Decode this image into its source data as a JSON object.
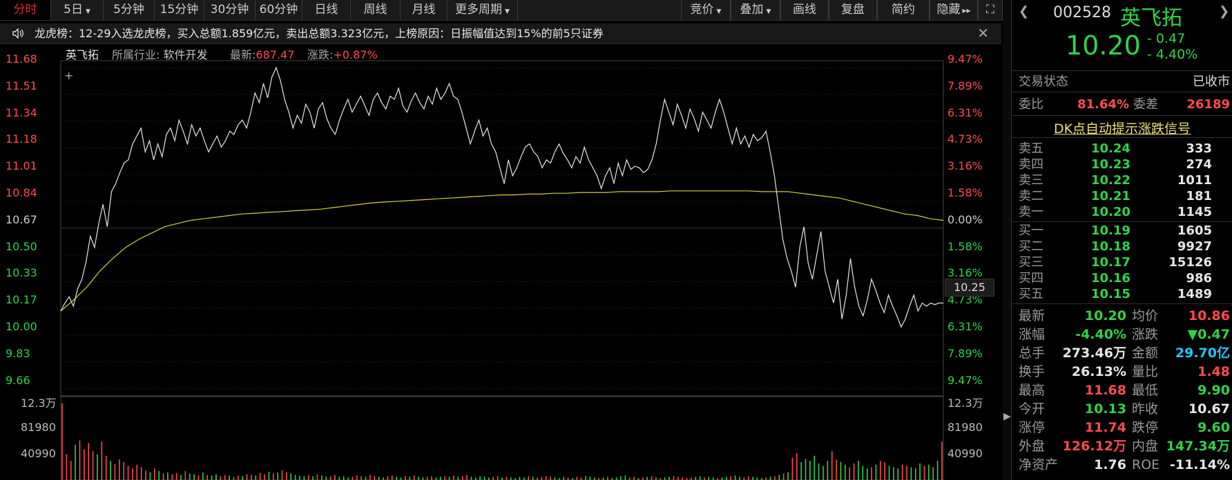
{
  "tabs": [
    {
      "label": "分时",
      "active": true
    },
    {
      "label": "5日",
      "dropdown": true
    },
    {
      "label": "5分钟"
    },
    {
      "label": "15分钟"
    },
    {
      "label": "30分钟"
    },
    {
      "label": "60分钟"
    },
    {
      "label": "日线"
    },
    {
      "label": "周线"
    },
    {
      "label": "月线"
    },
    {
      "label": "更多周期",
      "dropdown": true
    }
  ],
  "toolbar": [
    {
      "label": "竞价",
      "dropdown": true
    },
    {
      "label": "叠加",
      "dropdown": true
    },
    {
      "label": "画线"
    },
    {
      "label": "复盘"
    },
    {
      "label": "简约"
    },
    {
      "label": "隐藏",
      "arrows": "▸▸"
    }
  ],
  "notice": "龙虎榜：12-29入选龙虎榜，买入总额1.859亿元，卖出总额3.323亿元，上榜原因：日振幅值达到15%的前5只证券",
  "info": {
    "name": "英飞拓",
    "industry_label": "所属行业:",
    "industry": "软件开发",
    "latest_label": "最新:",
    "latest": "687.47",
    "change_label": "涨跌:",
    "change": "+0.87%"
  },
  "price_axis": [
    "11.68",
    "11.51",
    "11.34",
    "11.18",
    "11.01",
    "10.84",
    "10.67",
    "10.50",
    "10.33",
    "10.17",
    "10.00",
    "9.83",
    "9.66"
  ],
  "pct_axis": [
    "9.47%",
    "7.89%",
    "6.31%",
    "4.73%",
    "3.16%",
    "1.58%",
    "0.00%",
    "1.58%",
    "3.16%",
    "4.73%",
    "6.31%",
    "7.89%",
    "9.47%"
  ],
  "crosshair_price": "10.25",
  "vol_axis": [
    "12.3万",
    "81980",
    "40990"
  ],
  "colors": {
    "up": "#ff4b4b",
    "down": "#2fd34a",
    "neutral": "#e8e8e8",
    "avg": "#d8d033",
    "accent": "#1ea0ff"
  },
  "stock": {
    "code": "002528",
    "name": "英飞拓",
    "price": "10.20",
    "change": "- 0.47",
    "change_pct": "- 4.40%"
  },
  "status": {
    "label": "交易状态",
    "value": "已收市"
  },
  "wei": {
    "ratio_label": "委比",
    "ratio": "81.64%",
    "diff_label": "委差",
    "diff": "26189"
  },
  "dk_signal": "DK点自动提示涨跌信号",
  "sells": [
    {
      "label": "卖五",
      "price": "10.24",
      "vol": "333"
    },
    {
      "label": "卖四",
      "price": "10.23",
      "vol": "274"
    },
    {
      "label": "卖三",
      "price": "10.22",
      "vol": "1011"
    },
    {
      "label": "卖二",
      "price": "10.21",
      "vol": "181"
    },
    {
      "label": "卖一",
      "price": "10.20",
      "vol": "1145"
    }
  ],
  "buys": [
    {
      "label": "买一",
      "price": "10.19",
      "vol": "1605"
    },
    {
      "label": "买二",
      "price": "10.18",
      "vol": "9927"
    },
    {
      "label": "买三",
      "price": "10.17",
      "vol": "15126"
    },
    {
      "label": "买四",
      "price": "10.16",
      "vol": "986"
    },
    {
      "label": "买五",
      "price": "10.15",
      "vol": "1489"
    }
  ],
  "stats": [
    [
      {
        "l": "最新",
        "v": "10.20",
        "c": "green"
      },
      {
        "l": "均价",
        "v": "10.86",
        "c": "red"
      }
    ],
    [
      {
        "l": "涨幅",
        "v": "-4.40%",
        "c": "green"
      },
      {
        "l": "涨跌",
        "v": "▼0.47",
        "c": "green"
      }
    ],
    [
      {
        "l": "总手",
        "v": "273.46万",
        "c": "white"
      },
      {
        "l": "金额",
        "v": "29.70亿",
        "c": "blue"
      }
    ],
    [
      {
        "l": "换手",
        "v": "26.13%",
        "c": "white"
      },
      {
        "l": "量比",
        "v": "1.48",
        "c": "red"
      }
    ],
    [
      {
        "l": "最高",
        "v": "11.68",
        "c": "red"
      },
      {
        "l": "最低",
        "v": "9.90",
        "c": "green"
      }
    ],
    [
      {
        "l": "今开",
        "v": "10.13",
        "c": "green"
      },
      {
        "l": "昨收",
        "v": "10.67",
        "c": "white"
      }
    ],
    [
      {
        "l": "涨停",
        "v": "11.74",
        "c": "red"
      },
      {
        "l": "跌停",
        "v": "9.60",
        "c": "green"
      }
    ],
    [
      {
        "l": "外盘",
        "v": "126.12万",
        "c": "red"
      },
      {
        "l": "内盘",
        "v": "147.34万",
        "c": "green"
      }
    ],
    [
      {
        "l": "净资产",
        "v": "1.76",
        "c": "white"
      },
      {
        "l": "ROE",
        "v": "-11.14%",
        "c": "white"
      }
    ]
  ],
  "chart_data": {
    "type": "line",
    "title": "",
    "series": [
      {
        "values": [
          10.15,
          10.2,
          10.24,
          10.18,
          10.29,
          10.35,
          10.46,
          10.62,
          10.55,
          10.7,
          10.82,
          10.68,
          10.9,
          10.95,
          11.02,
          11.08,
          11.1,
          11.2,
          11.25,
          11.3,
          11.15,
          11.22,
          11.1,
          11.2,
          11.12,
          11.26,
          11.3,
          11.22,
          11.35,
          11.28,
          11.2,
          11.32,
          11.25,
          11.3,
          11.22,
          11.15,
          11.2,
          11.25,
          11.18,
          11.22,
          11.28,
          11.26,
          11.32,
          11.35,
          11.3,
          11.4,
          11.52,
          11.46,
          11.58,
          11.49,
          11.62,
          11.68,
          11.6,
          11.48,
          11.4,
          11.3,
          11.38,
          11.33,
          11.45,
          11.4,
          11.3,
          11.42,
          11.46,
          11.36,
          11.3,
          11.26,
          11.35,
          11.42,
          11.48,
          11.4,
          11.45,
          11.5,
          11.44,
          11.38,
          11.48,
          11.52,
          11.46,
          11.42,
          11.5,
          11.48,
          11.55,
          11.44,
          11.4,
          11.47,
          11.52,
          11.46,
          11.42,
          11.5,
          11.45,
          11.55,
          11.48,
          11.52,
          11.58,
          11.5,
          11.48,
          11.4,
          11.3,
          11.2,
          11.28,
          11.35,
          11.25,
          11.3,
          11.2,
          11.15,
          11.05,
          10.95,
          11.1,
          11.0,
          11.05,
          11.12,
          11.18,
          11.2,
          11.15,
          11.12,
          11.05,
          11.1,
          11.08,
          11.15,
          11.2,
          11.14,
          11.1,
          11.05,
          11.12,
          11.08,
          11.18,
          11.1,
          11.05,
          11.0,
          10.92,
          11.0,
          11.05,
          10.95,
          11.08,
          11.0,
          11.1,
          11.04,
          11.06,
          11.05,
          11.02,
          11.04,
          11.1,
          11.2,
          11.35,
          11.48,
          11.4,
          11.32,
          11.45,
          11.38,
          11.3,
          11.42,
          11.36,
          11.28,
          11.4,
          11.35,
          11.3,
          11.4,
          11.48,
          11.4,
          11.3,
          11.2,
          11.3,
          11.2,
          11.25,
          11.18,
          11.26,
          11.22,
          11.24,
          11.28,
          11.15,
          11.0,
          10.8,
          10.6,
          10.48,
          10.4,
          10.3,
          10.55,
          10.68,
          10.45,
          10.35,
          10.5,
          10.65,
          10.4,
          10.3,
          10.2,
          10.35,
          10.1,
          10.25,
          10.48,
          10.3,
          10.18,
          10.12,
          10.22,
          10.35,
          10.28,
          10.2,
          10.14,
          10.25,
          10.18,
          10.12,
          10.05,
          10.1,
          10.18,
          10.25,
          10.15,
          10.2,
          10.18,
          10.2,
          10.19,
          10.2,
          10.2
        ]
      },
      {
        "values": [
          10.15,
          10.22,
          10.3,
          10.4,
          10.48,
          10.55,
          10.6,
          10.64,
          10.68,
          10.7,
          10.72,
          10.73,
          10.74,
          10.75,
          10.76,
          10.765,
          10.77,
          10.775,
          10.78,
          10.785,
          10.79,
          10.8,
          10.81,
          10.82,
          10.83,
          10.835,
          10.84,
          10.845,
          10.85,
          10.855,
          10.86,
          10.865,
          10.87,
          10.875,
          10.88,
          10.88,
          10.885,
          10.885,
          10.89,
          10.89,
          10.895,
          10.895,
          10.895,
          10.9,
          10.9,
          10.9,
          10.9,
          10.905,
          10.905,
          10.905,
          10.905,
          10.905,
          10.905,
          10.905,
          10.9,
          10.9,
          10.9,
          10.89,
          10.88,
          10.87,
          10.86,
          10.84,
          10.82,
          10.8,
          10.78,
          10.76,
          10.75,
          10.73,
          10.72
        ]
      }
    ],
    "ylim": [
      9.66,
      11.68
    ],
    "volume": [
      120000,
      40000,
      30000,
      55000,
      62000,
      48000,
      58000,
      45000,
      40000,
      60000,
      38000,
      30000,
      25000,
      32000,
      28000,
      22000,
      18000,
      24000,
      20000,
      15000,
      12000,
      18000,
      14000,
      10000,
      12000,
      9000,
      11000,
      8000,
      14000,
      10000,
      9000,
      7000,
      12000,
      8000,
      7000,
      9000,
      6000,
      8000,
      7000,
      5000,
      7000,
      6000,
      9000,
      8000,
      7000,
      11000,
      9000,
      13000,
      10000,
      12000,
      15000,
      12000,
      10000,
      8000,
      7000,
      6000,
      8000,
      6000,
      9000,
      7000,
      5000,
      6000,
      8000,
      5000,
      6000,
      4000,
      5000,
      7000,
      6000,
      5000,
      8000,
      6000,
      5000,
      4000,
      6000,
      7000,
      5000,
      4000,
      6000,
      5000,
      7000,
      5000,
      4000,
      5000,
      6000,
      4000,
      5000,
      6000,
      5000,
      7000,
      5000,
      6000,
      8000,
      5000,
      4000,
      6000,
      5000,
      4000,
      5000,
      6000,
      4000,
      5000,
      4000,
      3000,
      5000,
      4000,
      6000,
      5000,
      4000,
      5000,
      6000,
      5000,
      4000,
      3000,
      5000,
      4000,
      3000,
      5000,
      4000,
      6000,
      5000,
      4000,
      3000,
      4000,
      5000,
      3000,
      4000,
      6000,
      7000,
      4000,
      5000,
      3000,
      4000,
      5000,
      6000,
      4000,
      3000,
      4000,
      5000,
      6000,
      5000,
      4000,
      3000,
      4000,
      5000,
      6000,
      4000,
      5000,
      4000,
      3000,
      4000,
      5000,
      6000,
      7000,
      5000,
      4000,
      6000,
      5000,
      4000,
      3000,
      4000,
      5000,
      6000,
      8000,
      10000,
      12000,
      35000,
      42000,
      28000,
      33000,
      30000,
      38000,
      26000,
      22000,
      30000,
      45000,
      32000,
      28000,
      24000,
      20000,
      26000,
      30000,
      22000,
      18000,
      20000,
      24000,
      30000,
      28000,
      22000,
      20000,
      18000,
      24000,
      22000,
      20000,
      18000,
      26000,
      22000,
      24000,
      20000,
      30000,
      60000
    ],
    "prev_close": 10.67
  }
}
